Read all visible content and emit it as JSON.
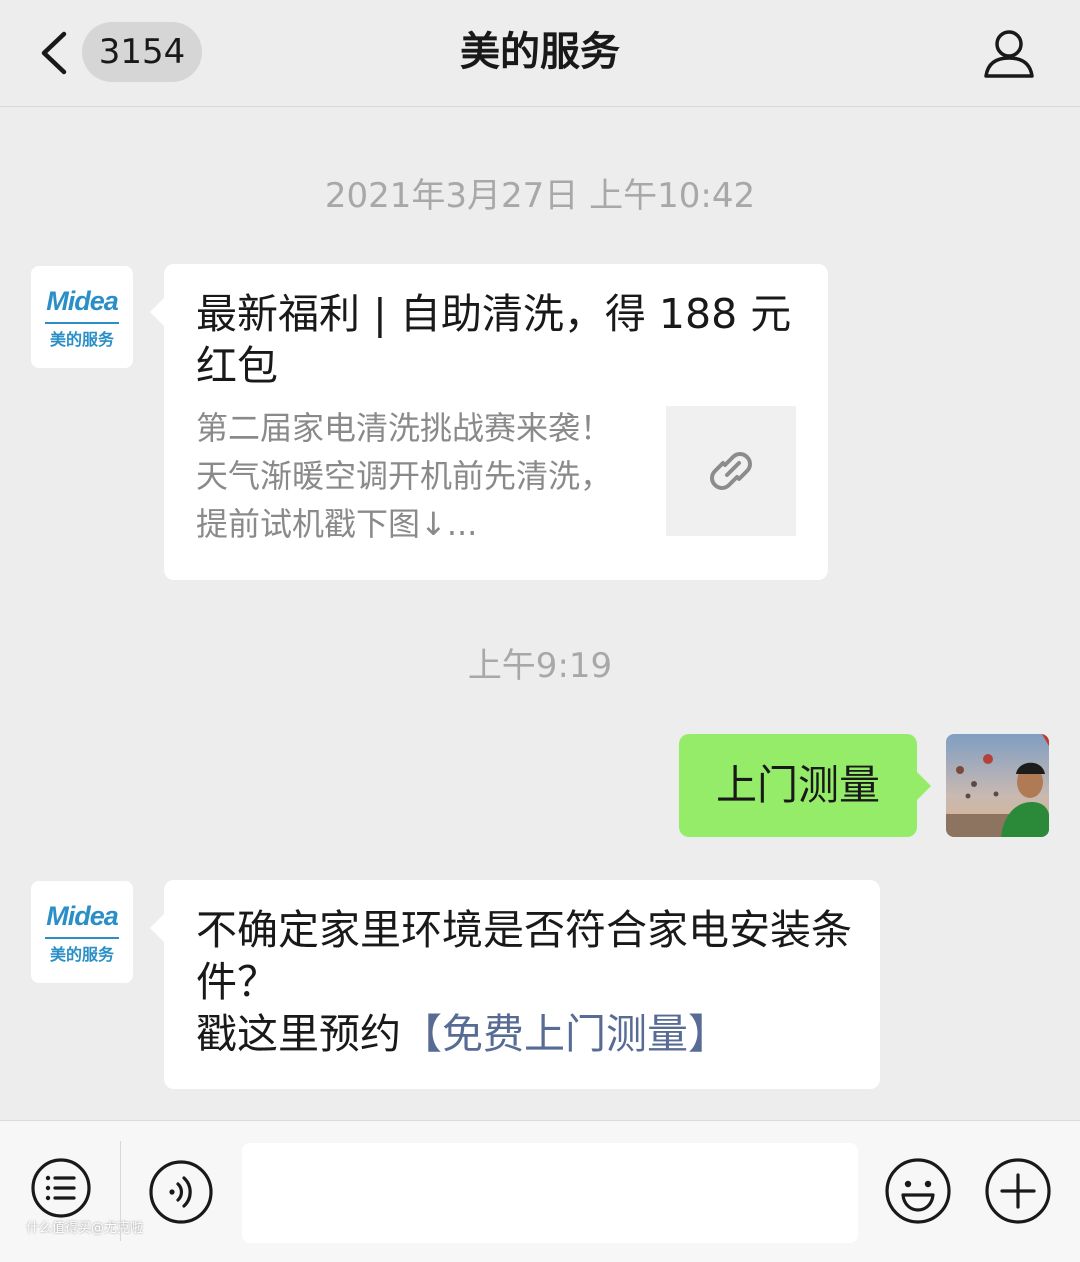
{
  "header": {
    "back_icon": "chevron-left-icon",
    "unread_count": "3154",
    "title": "美的服务",
    "profile_icon": "person-icon"
  },
  "messages": [
    {
      "type": "timestamp",
      "text": "2021年3月27日 上午10:42"
    },
    {
      "type": "link_card",
      "sender": "美的服务",
      "avatar_logo": "Midea",
      "avatar_sub": "美的服务",
      "title": "最新福利 | 自助清洗，得 188 元红包",
      "description": "第二届家电清洗挑战赛来袭！天气渐暖空调开机前先清洗，提前试机戳下图↓...",
      "thumb_icon": "link-icon"
    },
    {
      "type": "timestamp",
      "text": "上午9:19"
    },
    {
      "type": "sent_text",
      "text": "上门测量"
    },
    {
      "type": "received_text",
      "sender": "美的服务",
      "avatar_logo": "Midea",
      "avatar_sub": "美的服务",
      "line1": "不确定家里环境是否符合家电安装条件？",
      "line2_prefix": "戳这里预约",
      "line2_link": "【免费上门测量】"
    }
  ],
  "input_bar": {
    "menu_icon": "menu-list-icon",
    "voice_icon": "voice-icon",
    "input_value": "",
    "emoji_icon": "emoji-icon",
    "plus_icon": "plus-icon",
    "watermark": "什么值得买@尤克啦"
  },
  "colors": {
    "background": "#ededed",
    "sent_bubble": "#95ec69",
    "link_text": "#576b95",
    "midea_blue": "#2a8fc7",
    "timestamp": "#a8a8a8"
  }
}
